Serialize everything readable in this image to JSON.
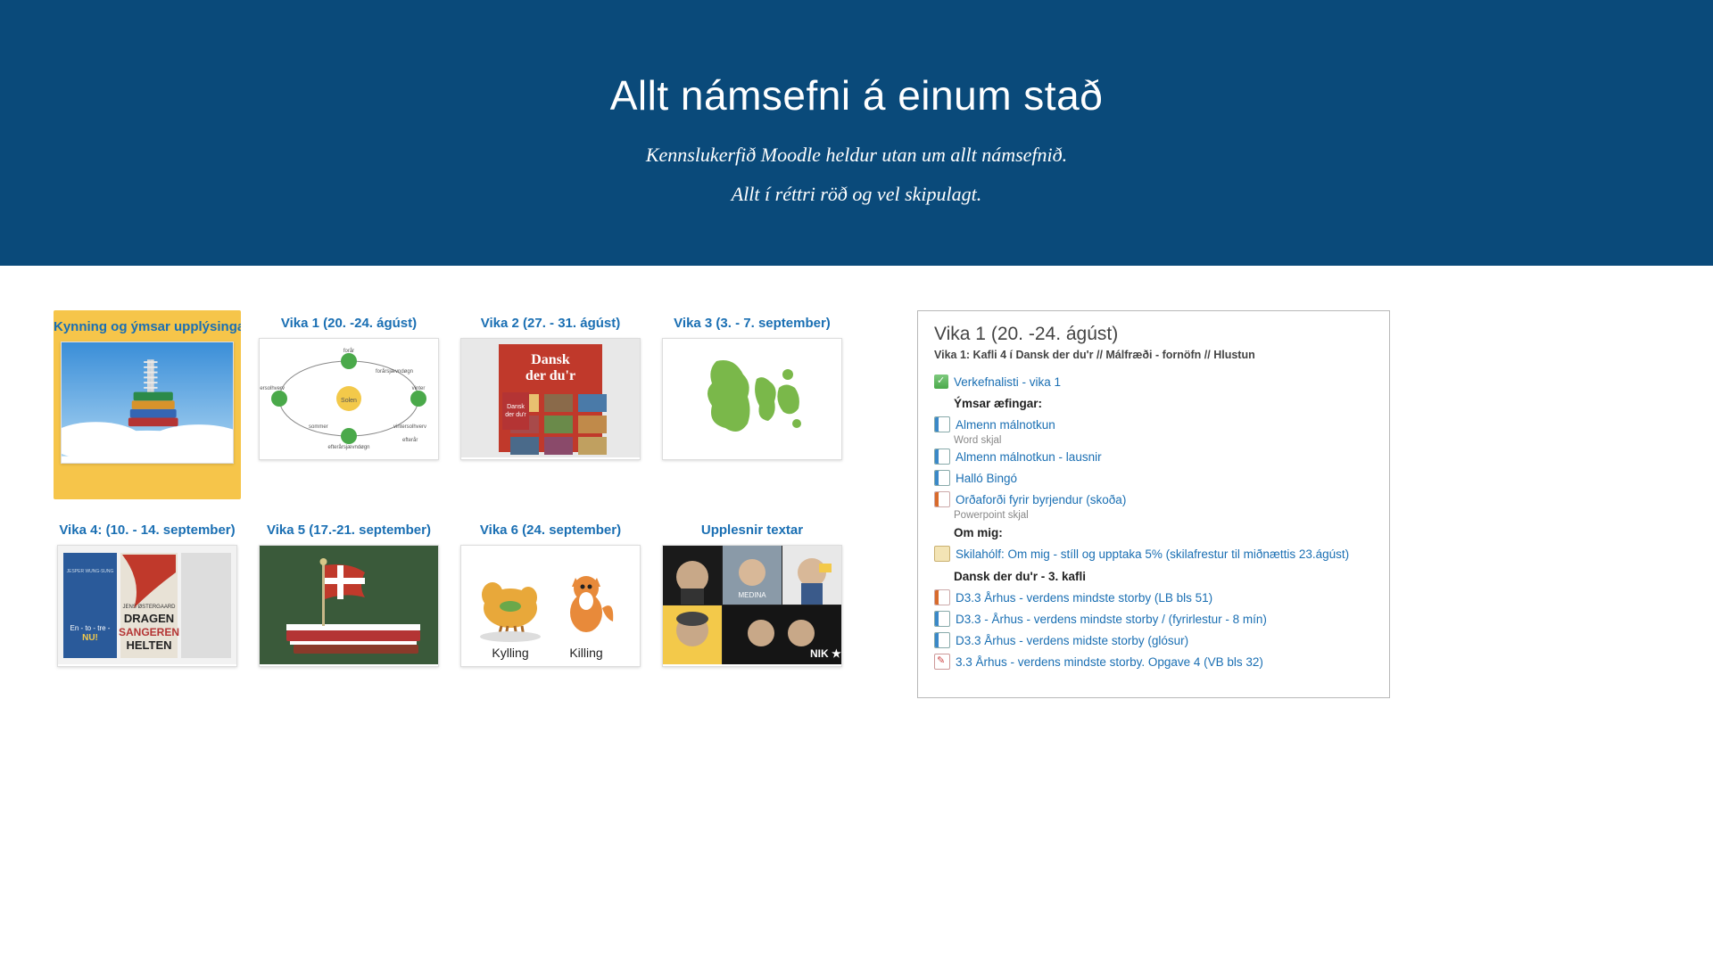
{
  "hero": {
    "title": "Allt námsefni á einum stað",
    "sub1": "Kennslukerfið Moodle heldur utan um allt námsefnið.",
    "sub2": "Allt í réttri röð og vel skipulagt."
  },
  "cards": [
    {
      "title": "Kynning og ýmsar upplýsingar",
      "active": true,
      "art": "books-sky"
    },
    {
      "title": "Vika 1 (20. -24. ágúst)",
      "art": "orbit"
    },
    {
      "title": "Vika 2 (27. - 31. ágúst)",
      "art": "dansk"
    },
    {
      "title": "Vika 3 (3. - 7. september)",
      "art": "denmark"
    },
    {
      "title": "Vika 4: (10. - 14. september)",
      "art": "books-covers"
    },
    {
      "title": "Vika 5 (17.-21. september)",
      "art": "flag-books"
    },
    {
      "title": "Vika 6 (24. september)",
      "art": "kylling",
      "labels": [
        "Kylling",
        "Killing"
      ]
    },
    {
      "title": "Upplesnir textar",
      "art": "photos"
    }
  ],
  "panel": {
    "heading": "Vika 1 (20. -24. ágúst)",
    "crumb": "Vika 1: Kafli 4 í Dansk der du'r // Málfræði - fornöfn // Hlustun",
    "items": [
      {
        "type": "link",
        "icon": "check",
        "text": "Verkefnalisti - vika 1"
      },
      {
        "type": "bold",
        "text": "Ýmsar æfingar:"
      },
      {
        "type": "link",
        "icon": "doc",
        "text": "Almenn málnotkun"
      },
      {
        "type": "muted",
        "text": "Word skjal"
      },
      {
        "type": "link",
        "icon": "doc",
        "text": "Almenn málnotkun - lausnir"
      },
      {
        "type": "link",
        "icon": "doc",
        "text": "Halló Bingó"
      },
      {
        "type": "link",
        "icon": "ppt",
        "text": "Orðaforði fyrir byrjendur (skoða)"
      },
      {
        "type": "muted",
        "text": "Powerpoint skjal"
      },
      {
        "type": "bold",
        "text": "Om mig:"
      },
      {
        "type": "link",
        "icon": "box",
        "text": "Skilahólf: Om mig - stíll og upptaka 5% (skilafrestur til miðnættis 23.ágúst)"
      },
      {
        "type": "bold",
        "text": "Dansk der du'r - 3. kafli"
      },
      {
        "type": "link",
        "icon": "ppt",
        "text": "D3.3 Århus - verdens mindste storby (LB bls 51)"
      },
      {
        "type": "link",
        "icon": "doc",
        "text": "D3.3 - Århus - verdens mindste storby / (fyrirlestur - 8 mín)",
        "indent": 1
      },
      {
        "type": "link",
        "icon": "doc",
        "text": "D3.3 Århus - verdens midste storby (glósur)",
        "indent": 1
      },
      {
        "type": "link",
        "icon": "pencil",
        "text": "3.3 Århus - verdens mindste storby. Opgave 4 (VB bls 32)",
        "indent": 2
      }
    ]
  }
}
